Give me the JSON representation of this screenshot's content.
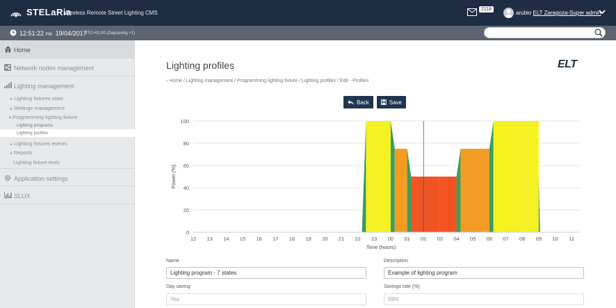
{
  "topbar": {
    "brand": "STELaRia",
    "app_title": "Wireless Remote Street Lighting CMS",
    "mail_count": "2118",
    "user": "arubio",
    "org": "ELT Zaragoza-Super admin"
  },
  "status": {
    "time": "12:51:22",
    "ampm": "PM",
    "date": "19/04/2017",
    "tz": "UTC+01:00 (Daysaving +1)",
    "search_placeholder": ""
  },
  "sidebar": {
    "home": "Home",
    "network": "Network nodes management",
    "lighting": "Lighting management",
    "sub": {
      "state": "Lighting fixtures state",
      "settings": "Settings management",
      "programming": "Programming lighting fixture",
      "programs": "Lighting programs",
      "profiles": "Lighting profiles",
      "events": "Lighting fixtures events",
      "reports": "Reports",
      "tests": "Lighting fixture tests"
    },
    "app_settings": "Application settings",
    "slux": "SLUX"
  },
  "main": {
    "title": "Lighting profiles",
    "brand_logo": "ELT",
    "breadcrumb": "Home / Lighting management / Programming lighting fixture / Lighting profiles / Edit - Profiles",
    "back_label": "Back",
    "save_label": "Save"
  },
  "chart_data": {
    "type": "area",
    "xlabel": "Time (hours)",
    "ylabel": "Power (%)",
    "ylim": [
      0,
      100
    ],
    "x_ticks": [
      "12",
      "13",
      "14",
      "15",
      "16",
      "17",
      "18",
      "19",
      "20",
      "21",
      "22",
      "23",
      "00",
      "01",
      "02",
      "03",
      "04",
      "05",
      "06",
      "07",
      "08",
      "09",
      "10",
      "11"
    ],
    "y_ticks": [
      0,
      20,
      40,
      60,
      80,
      100
    ],
    "grid": "horizontal",
    "current_time_marker": "02:00",
    "segments": [
      {
        "from": "22:15",
        "to": "22:30",
        "level_from": 0,
        "level_to": 100,
        "color": "#3d9a5a"
      },
      {
        "from": "22:30",
        "to": "00:00",
        "level": 100,
        "color": "#f4f21c"
      },
      {
        "from": "00:00",
        "to": "00:15",
        "level_from": 100,
        "level_to": 75,
        "color": "#3d9a5a"
      },
      {
        "from": "00:15",
        "to": "01:00",
        "level": 75,
        "color": "#f39a1e"
      },
      {
        "from": "01:00",
        "to": "01:15",
        "level_from": 75,
        "level_to": 50,
        "color": "#3d9a5a"
      },
      {
        "from": "01:15",
        "to": "03:00",
        "level": 50,
        "color": "#f0501c"
      },
      {
        "from": "03:00",
        "to": "04:00",
        "level": 50,
        "color": "#f0501c"
      },
      {
        "from": "04:00",
        "to": "04:15",
        "level_from": 50,
        "level_to": 75,
        "color": "#3d9a5a"
      },
      {
        "from": "04:15",
        "to": "06:00",
        "level": 75,
        "color": "#f39a1e"
      },
      {
        "from": "06:00",
        "to": "06:15",
        "level_from": 75,
        "level_to": 100,
        "color": "#3d9a5a"
      },
      {
        "from": "06:15",
        "to": "09:00",
        "level": 100,
        "color": "#f4f21c"
      },
      {
        "from": "09:00",
        "to": "09:05",
        "level_from": 50,
        "level_to": 0,
        "color": "#3d9a5a"
      }
    ]
  },
  "form": {
    "name_label": "Name",
    "name_value": "Lighting program - 7 states",
    "description_label": "Description",
    "description_value": "Example of lighting program",
    "daysaving_label": "Day saving",
    "daysaving_value": "Yes",
    "savings_label": "Savings rate (%)",
    "savings_value": "59%"
  }
}
